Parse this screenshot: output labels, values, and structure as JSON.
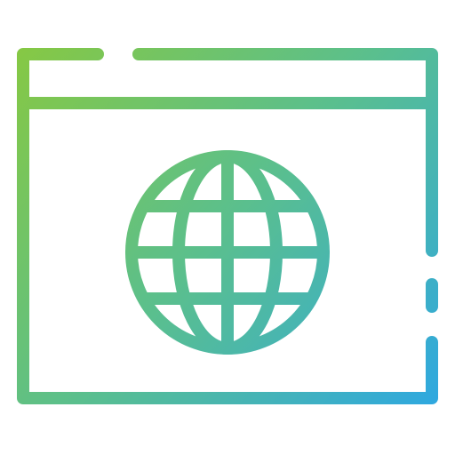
{
  "icon": {
    "name": "browser-window-globe-icon",
    "parts": [
      "browser-window-icon",
      "globe-icon"
    ],
    "gradient": {
      "start": "#86c844",
      "mid": "#5abf8e",
      "end": "#2fa8e0"
    },
    "background": "#ffffff"
  }
}
